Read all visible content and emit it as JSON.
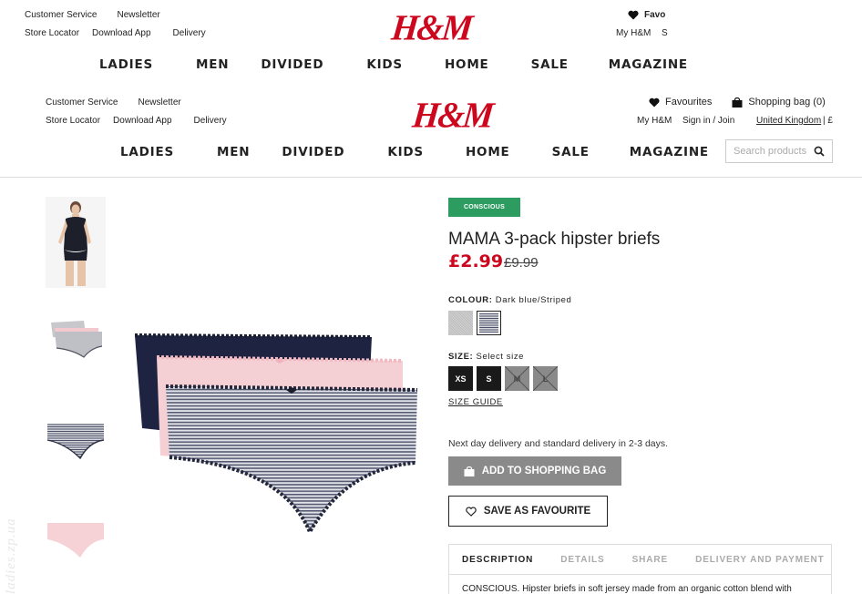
{
  "header_top": {
    "util_left": {
      "row1": [
        "Customer Service",
        "Newsletter"
      ],
      "row2": [
        "Store Locator",
        "Download App",
        "Delivery"
      ]
    },
    "logo": "H&M",
    "util_right": {
      "favourites": "Favo",
      "my_hm": "My H&M",
      "sign_in": "S"
    },
    "nav": [
      "LADIES",
      "MEN",
      "DIVIDED",
      "KIDS",
      "HOME",
      "SALE",
      "MAGAZINE"
    ]
  },
  "header": {
    "util_left": {
      "row1": [
        "Customer Service",
        "Newsletter"
      ],
      "row2": [
        "Store Locator",
        "Download App",
        "Delivery"
      ]
    },
    "logo": "H&M",
    "util_right": {
      "favourites": "Favourites",
      "shopping_bag": "Shopping bag (0)",
      "my_hm": "My H&M",
      "sign_in": "Sign in / Join",
      "country": "United Kingdom",
      "country_sep": "| £"
    },
    "nav": [
      "LADIES",
      "MEN",
      "DIVIDED",
      "KIDS",
      "HOME",
      "SALE",
      "MAGAZINE"
    ],
    "search": {
      "placeholder": "Search products"
    }
  },
  "product": {
    "badge": "CONSCIOUS",
    "title": "MAMA 3-pack hipster briefs",
    "price": "£2.99",
    "old_price": "£9.99",
    "colour_label": "COLOUR:",
    "colour_value": "Dark blue/Striped",
    "size_label": "SIZE:",
    "size_value": "Select size",
    "sizes": [
      "XS",
      "S",
      "M",
      "L"
    ],
    "size_guide": "SIZE GUIDE",
    "delivery": "Next day delivery and standard delivery in 2-3 days.",
    "add_to_bag": "ADD TO SHOPPING BAG",
    "save_fav": "SAVE AS FAVOURITE",
    "tabs": [
      "DESCRIPTION",
      "DETAILS",
      "SHARE",
      "DELIVERY AND PAYMENT"
    ],
    "description": "CONSCIOUS. Hipster briefs in soft jersey made from an organic cotton blend with"
  },
  "watermark": "ladies.zp.ua",
  "colors": {
    "brand": "#cc071e",
    "conscious": "#2d9c61",
    "button_gray": "#8a8a8a"
  }
}
